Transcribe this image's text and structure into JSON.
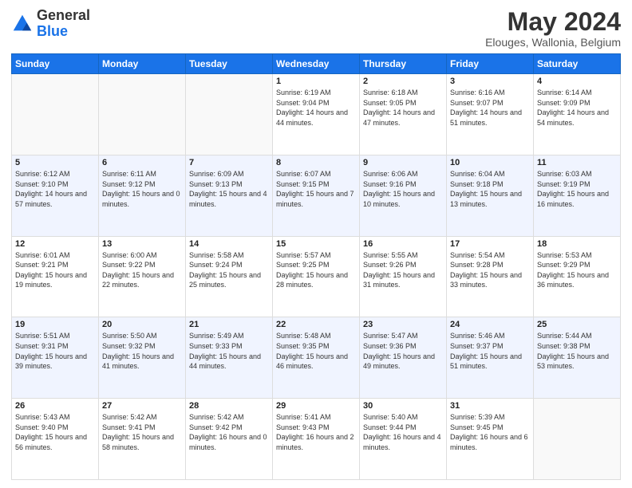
{
  "logo": {
    "line1": "General",
    "line2": "Blue"
  },
  "title": "May 2024",
  "location": "Elouges, Wallonia, Belgium",
  "weekdays": [
    "Sunday",
    "Monday",
    "Tuesday",
    "Wednesday",
    "Thursday",
    "Friday",
    "Saturday"
  ],
  "weeks": [
    [
      {
        "day": "",
        "sunrise": "",
        "sunset": "",
        "daylight": ""
      },
      {
        "day": "",
        "sunrise": "",
        "sunset": "",
        "daylight": ""
      },
      {
        "day": "",
        "sunrise": "",
        "sunset": "",
        "daylight": ""
      },
      {
        "day": "1",
        "sunrise": "Sunrise: 6:19 AM",
        "sunset": "Sunset: 9:04 PM",
        "daylight": "Daylight: 14 hours and 44 minutes."
      },
      {
        "day": "2",
        "sunrise": "Sunrise: 6:18 AM",
        "sunset": "Sunset: 9:05 PM",
        "daylight": "Daylight: 14 hours and 47 minutes."
      },
      {
        "day": "3",
        "sunrise": "Sunrise: 6:16 AM",
        "sunset": "Sunset: 9:07 PM",
        "daylight": "Daylight: 14 hours and 51 minutes."
      },
      {
        "day": "4",
        "sunrise": "Sunrise: 6:14 AM",
        "sunset": "Sunset: 9:09 PM",
        "daylight": "Daylight: 14 hours and 54 minutes."
      }
    ],
    [
      {
        "day": "5",
        "sunrise": "Sunrise: 6:12 AM",
        "sunset": "Sunset: 9:10 PM",
        "daylight": "Daylight: 14 hours and 57 minutes."
      },
      {
        "day": "6",
        "sunrise": "Sunrise: 6:11 AM",
        "sunset": "Sunset: 9:12 PM",
        "daylight": "Daylight: 15 hours and 0 minutes."
      },
      {
        "day": "7",
        "sunrise": "Sunrise: 6:09 AM",
        "sunset": "Sunset: 9:13 PM",
        "daylight": "Daylight: 15 hours and 4 minutes."
      },
      {
        "day": "8",
        "sunrise": "Sunrise: 6:07 AM",
        "sunset": "Sunset: 9:15 PM",
        "daylight": "Daylight: 15 hours and 7 minutes."
      },
      {
        "day": "9",
        "sunrise": "Sunrise: 6:06 AM",
        "sunset": "Sunset: 9:16 PM",
        "daylight": "Daylight: 15 hours and 10 minutes."
      },
      {
        "day": "10",
        "sunrise": "Sunrise: 6:04 AM",
        "sunset": "Sunset: 9:18 PM",
        "daylight": "Daylight: 15 hours and 13 minutes."
      },
      {
        "day": "11",
        "sunrise": "Sunrise: 6:03 AM",
        "sunset": "Sunset: 9:19 PM",
        "daylight": "Daylight: 15 hours and 16 minutes."
      }
    ],
    [
      {
        "day": "12",
        "sunrise": "Sunrise: 6:01 AM",
        "sunset": "Sunset: 9:21 PM",
        "daylight": "Daylight: 15 hours and 19 minutes."
      },
      {
        "day": "13",
        "sunrise": "Sunrise: 6:00 AM",
        "sunset": "Sunset: 9:22 PM",
        "daylight": "Daylight: 15 hours and 22 minutes."
      },
      {
        "day": "14",
        "sunrise": "Sunrise: 5:58 AM",
        "sunset": "Sunset: 9:24 PM",
        "daylight": "Daylight: 15 hours and 25 minutes."
      },
      {
        "day": "15",
        "sunrise": "Sunrise: 5:57 AM",
        "sunset": "Sunset: 9:25 PM",
        "daylight": "Daylight: 15 hours and 28 minutes."
      },
      {
        "day": "16",
        "sunrise": "Sunrise: 5:55 AM",
        "sunset": "Sunset: 9:26 PM",
        "daylight": "Daylight: 15 hours and 31 minutes."
      },
      {
        "day": "17",
        "sunrise": "Sunrise: 5:54 AM",
        "sunset": "Sunset: 9:28 PM",
        "daylight": "Daylight: 15 hours and 33 minutes."
      },
      {
        "day": "18",
        "sunrise": "Sunrise: 5:53 AM",
        "sunset": "Sunset: 9:29 PM",
        "daylight": "Daylight: 15 hours and 36 minutes."
      }
    ],
    [
      {
        "day": "19",
        "sunrise": "Sunrise: 5:51 AM",
        "sunset": "Sunset: 9:31 PM",
        "daylight": "Daylight: 15 hours and 39 minutes."
      },
      {
        "day": "20",
        "sunrise": "Sunrise: 5:50 AM",
        "sunset": "Sunset: 9:32 PM",
        "daylight": "Daylight: 15 hours and 41 minutes."
      },
      {
        "day": "21",
        "sunrise": "Sunrise: 5:49 AM",
        "sunset": "Sunset: 9:33 PM",
        "daylight": "Daylight: 15 hours and 44 minutes."
      },
      {
        "day": "22",
        "sunrise": "Sunrise: 5:48 AM",
        "sunset": "Sunset: 9:35 PM",
        "daylight": "Daylight: 15 hours and 46 minutes."
      },
      {
        "day": "23",
        "sunrise": "Sunrise: 5:47 AM",
        "sunset": "Sunset: 9:36 PM",
        "daylight": "Daylight: 15 hours and 49 minutes."
      },
      {
        "day": "24",
        "sunrise": "Sunrise: 5:46 AM",
        "sunset": "Sunset: 9:37 PM",
        "daylight": "Daylight: 15 hours and 51 minutes."
      },
      {
        "day": "25",
        "sunrise": "Sunrise: 5:44 AM",
        "sunset": "Sunset: 9:38 PM",
        "daylight": "Daylight: 15 hours and 53 minutes."
      }
    ],
    [
      {
        "day": "26",
        "sunrise": "Sunrise: 5:43 AM",
        "sunset": "Sunset: 9:40 PM",
        "daylight": "Daylight: 15 hours and 56 minutes."
      },
      {
        "day": "27",
        "sunrise": "Sunrise: 5:42 AM",
        "sunset": "Sunset: 9:41 PM",
        "daylight": "Daylight: 15 hours and 58 minutes."
      },
      {
        "day": "28",
        "sunrise": "Sunrise: 5:42 AM",
        "sunset": "Sunset: 9:42 PM",
        "daylight": "Daylight: 16 hours and 0 minutes."
      },
      {
        "day": "29",
        "sunrise": "Sunrise: 5:41 AM",
        "sunset": "Sunset: 9:43 PM",
        "daylight": "Daylight: 16 hours and 2 minutes."
      },
      {
        "day": "30",
        "sunrise": "Sunrise: 5:40 AM",
        "sunset": "Sunset: 9:44 PM",
        "daylight": "Daylight: 16 hours and 4 minutes."
      },
      {
        "day": "31",
        "sunrise": "Sunrise: 5:39 AM",
        "sunset": "Sunset: 9:45 PM",
        "daylight": "Daylight: 16 hours and 6 minutes."
      },
      {
        "day": "",
        "sunrise": "",
        "sunset": "",
        "daylight": ""
      }
    ]
  ]
}
